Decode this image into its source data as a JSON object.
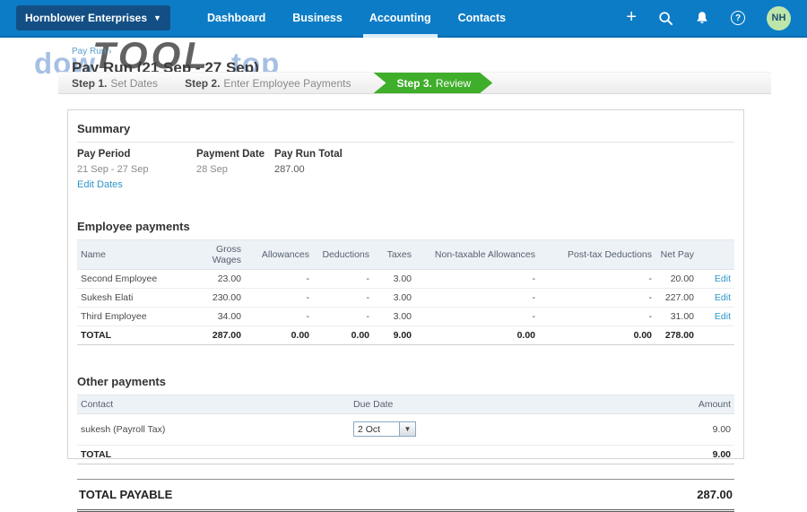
{
  "nav": {
    "org_label": "Hornblower Enterprises",
    "items": [
      "Dashboard",
      "Business",
      "Accounting",
      "Contacts"
    ],
    "active_item": "Accounting",
    "avatar_initials": "NH",
    "colors": {
      "bar": "#0d7cc6",
      "org_button": "#134f85",
      "active_underline": "#d9eef9",
      "avatar_bg": "#bfe6aa"
    }
  },
  "header": {
    "breadcrumb": "Pay Run ›",
    "title": "Pay Run (21 Sep - 27 Sep)"
  },
  "watermark": {
    "left": "dow",
    "center": "TOOL",
    "right": "top"
  },
  "steps": {
    "step1_prefix": "Step 1.",
    "step1_label": "Set Dates",
    "step2_prefix": "Step 2.",
    "step2_label": "Enter Employee Payments",
    "step3_prefix": "Step 3.",
    "step3_label": "Review",
    "active_color": "#3fae2a"
  },
  "summary": {
    "heading": "Summary",
    "pay_period_label": "Pay Period",
    "pay_period_value": "21 Sep - 27 Sep",
    "edit_dates_link": "Edit Dates",
    "payment_date_label": "Payment Date",
    "payment_date_value": "28 Sep",
    "pay_run_total_label": "Pay Run Total",
    "pay_run_total_value": "287.00"
  },
  "employee_payments": {
    "heading": "Employee payments",
    "columns": [
      "Name",
      "Gross Wages",
      "Allowances",
      "Deductions",
      "Taxes",
      "Non-taxable Allowances",
      "Post-tax Deductions",
      "Net Pay",
      ""
    ],
    "rows": [
      {
        "name": "Second Employee",
        "gross": "23.00",
        "allowances": "-",
        "deductions": "-",
        "taxes": "3.00",
        "nontax": "-",
        "posttax": "-",
        "net": "20.00",
        "action": "Edit"
      },
      {
        "name": "Sukesh Elati",
        "gross": "230.00",
        "allowances": "-",
        "deductions": "-",
        "taxes": "3.00",
        "nontax": "-",
        "posttax": "-",
        "net": "227.00",
        "action": "Edit"
      },
      {
        "name": "Third Employee",
        "gross": "34.00",
        "allowances": "-",
        "deductions": "-",
        "taxes": "3.00",
        "nontax": "-",
        "posttax": "-",
        "net": "31.00",
        "action": "Edit"
      }
    ],
    "total": {
      "name": "TOTAL",
      "gross": "287.00",
      "allowances": "0.00",
      "deductions": "0.00",
      "taxes": "9.00",
      "nontax": "0.00",
      "posttax": "0.00",
      "net": "278.00"
    }
  },
  "other_payments": {
    "heading": "Other payments",
    "columns": [
      "Contact",
      "Due Date",
      "Amount"
    ],
    "row": {
      "contact": "sukesh (Payroll Tax)",
      "due_date": "2 Oct",
      "amount": "9.00"
    },
    "total": {
      "label": "TOTAL",
      "amount": "9.00"
    }
  },
  "total_payable": {
    "label": "TOTAL PAYABLE",
    "amount": "287.00"
  }
}
